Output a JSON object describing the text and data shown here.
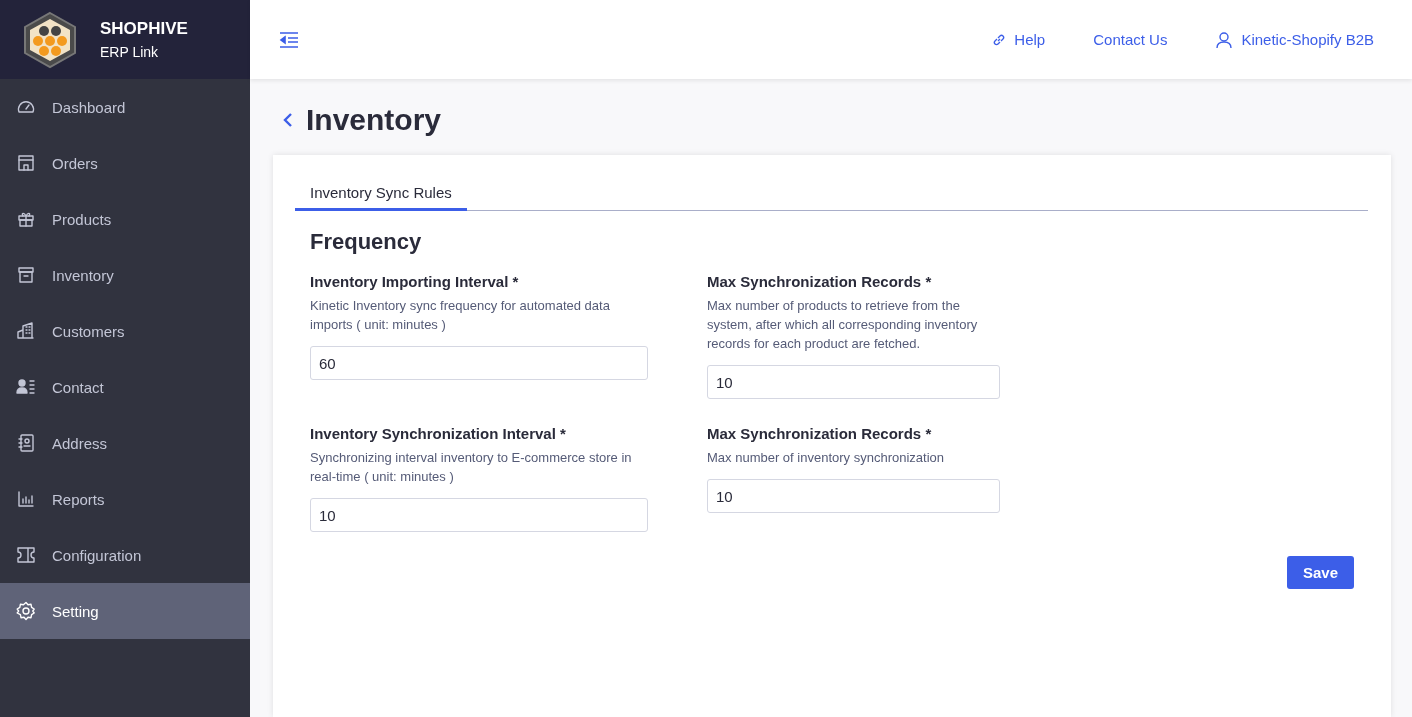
{
  "brand": {
    "name": "SHOPHIVE",
    "subtitle": "ERP Link"
  },
  "sidebar": {
    "items": [
      {
        "label": "Dashboard",
        "selected": false
      },
      {
        "label": "Orders",
        "selected": false
      },
      {
        "label": "Products",
        "selected": false
      },
      {
        "label": "Inventory",
        "selected": false
      },
      {
        "label": "Customers",
        "selected": false
      },
      {
        "label": "Contact",
        "selected": false
      },
      {
        "label": "Address",
        "selected": false
      },
      {
        "label": "Reports",
        "selected": false
      },
      {
        "label": "Configuration",
        "selected": false
      },
      {
        "label": "Setting",
        "selected": true
      }
    ]
  },
  "header": {
    "links": [
      "Help",
      "Contact Us"
    ],
    "user": "Kinetic-Shopify B2B"
  },
  "page": {
    "title": "Inventory"
  },
  "tabs": [
    {
      "label": "Inventory Sync Rules",
      "selected": true
    }
  ],
  "section": {
    "title": "Frequency",
    "fields": [
      {
        "label": "Inventory Importing Interval *",
        "description": "Kinetic Inventory sync frequency for automated data imports ( unit: minutes )",
        "value": "60"
      },
      {
        "label": "Max Synchronization Records *",
        "description": "Max number of products to retrieve from the system, after which all corresponding inventory records for each product are fetched.",
        "value": "10"
      },
      {
        "label": "Inventory Synchronization Interval *",
        "description": "Synchronizing interval inventory to E-commerce store in real-time ( unit: minutes )",
        "value": "10"
      },
      {
        "label": "Max Synchronization Records *",
        "description": "Max number of inventory synchronization",
        "value": "10"
      }
    ]
  },
  "save_button": "Save"
}
